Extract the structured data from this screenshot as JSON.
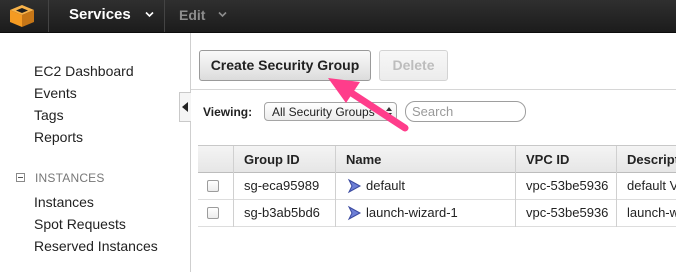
{
  "topbar": {
    "logo_icon": "aws-cube-icon",
    "services_label": "Services",
    "edit_label": "Edit",
    "bg_color": "#232323"
  },
  "sidebar": {
    "links": [
      {
        "label": "EC2 Dashboard"
      },
      {
        "label": "Events"
      },
      {
        "label": "Tags"
      },
      {
        "label": "Reports"
      }
    ],
    "section_instances": {
      "label": "INSTANCES",
      "items": [
        {
          "label": "Instances"
        },
        {
          "label": "Spot Requests"
        },
        {
          "label": "Reserved Instances"
        }
      ]
    }
  },
  "toolbar": {
    "create_label": "Create Security Group",
    "delete_label": "Delete"
  },
  "filter": {
    "viewing_label": "Viewing:",
    "selected_option": "All Security Groups",
    "search_placeholder": "Search"
  },
  "table": {
    "columns": [
      "Group ID",
      "Name",
      "VPC ID",
      "Descript"
    ],
    "rows": [
      {
        "group_id": "sg-eca95989",
        "name": "default",
        "vpc_id": "vpc-53be5936",
        "description": "default V"
      },
      {
        "group_id": "sg-b3ab5bd6",
        "name": "launch-wizard-1",
        "vpc_id": "vpc-53be5936",
        "description": "launch-w"
      }
    ]
  },
  "colors": {
    "annotation_arrow": "#ff3d8b",
    "logo_orange": "#f59b22",
    "security_group_icon": "#6d7fd6"
  }
}
